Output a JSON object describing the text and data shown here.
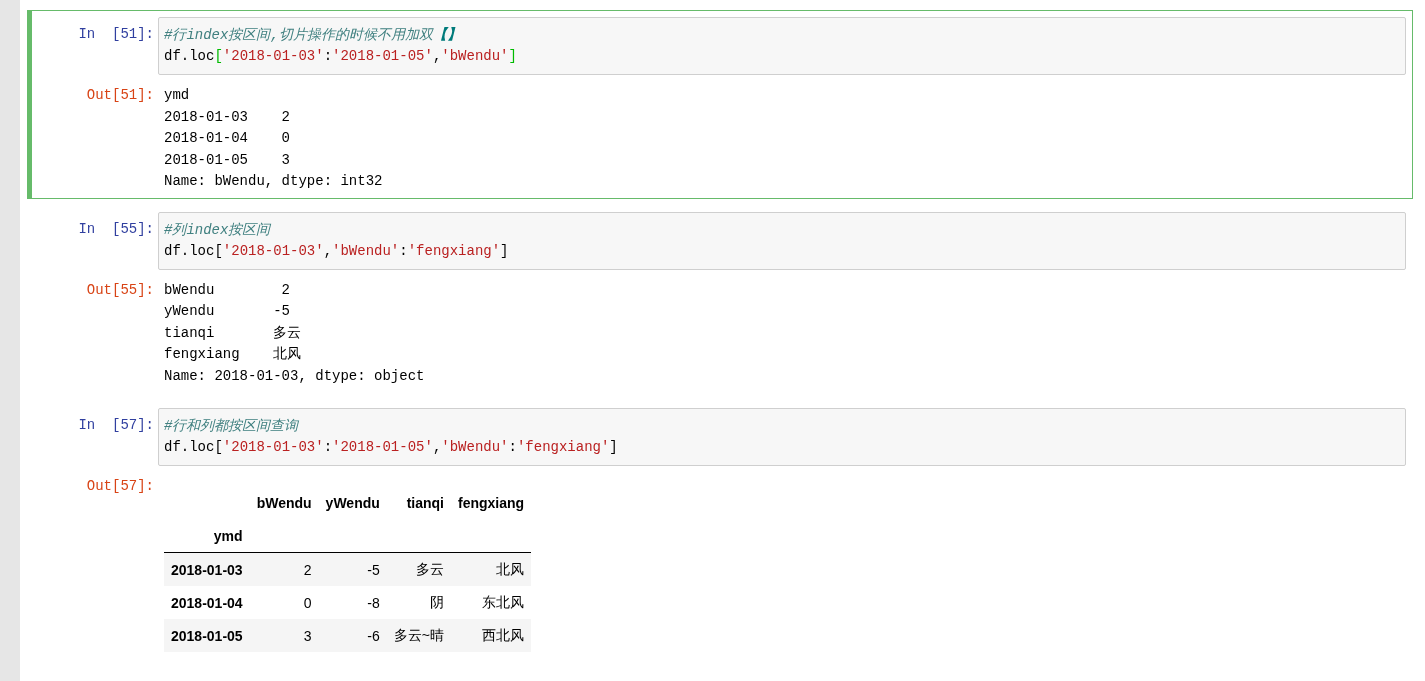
{
  "cells": [
    {
      "selected": true,
      "in_prompt": "In  [51]:",
      "out_prompt": "Out[51]:",
      "code": [
        [
          {
            "kind": "comment",
            "text": "#行index按区间,切片操作的时候不用加双**【】**"
          }
        ],
        [
          {
            "kind": "name",
            "text": "df.loc"
          },
          {
            "kind": "bracket_match",
            "text": "["
          },
          {
            "kind": "string",
            "text": "'2018-01-03'"
          },
          {
            "kind": "name",
            "text": ":"
          },
          {
            "kind": "string",
            "text": "'2018-01-05'"
          },
          {
            "kind": "name",
            "text": ","
          },
          {
            "kind": "string",
            "text": "'bWendu'"
          },
          {
            "kind": "bracket_match",
            "text": "]"
          }
        ]
      ],
      "output": {
        "kind": "text",
        "lines": [
          "ymd",
          "2018-01-03    2",
          "2018-01-04    0",
          "2018-01-05    3",
          "Name: bWendu, dtype: int32"
        ]
      }
    },
    {
      "selected": false,
      "in_prompt": "In  [55]:",
      "out_prompt": "Out[55]:",
      "code": [
        [
          {
            "kind": "comment",
            "text": "#列index按区间"
          }
        ],
        [
          {
            "kind": "name",
            "text": "df.loc"
          },
          {
            "kind": "bracket",
            "text": "["
          },
          {
            "kind": "string",
            "text": "'2018-01-03'"
          },
          {
            "kind": "name",
            "text": ","
          },
          {
            "kind": "string",
            "text": "'bWendu'"
          },
          {
            "kind": "name",
            "text": ":"
          },
          {
            "kind": "string",
            "text": "'fengxiang'"
          },
          {
            "kind": "bracket",
            "text": "]"
          }
        ]
      ],
      "output": {
        "kind": "text",
        "lines": [
          "bWendu        2",
          "yWendu       -5",
          "tianqi       多云",
          "fengxiang    北风",
          "Name: 2018-01-03, dtype: object"
        ]
      }
    },
    {
      "selected": false,
      "in_prompt": "In  [57]:",
      "out_prompt": "Out[57]:",
      "code": [
        [
          {
            "kind": "comment",
            "text": "#行和列都按区间查询"
          }
        ],
        [
          {
            "kind": "name",
            "text": "df.loc"
          },
          {
            "kind": "bracket",
            "text": "["
          },
          {
            "kind": "string",
            "text": "'2018-01-03'"
          },
          {
            "kind": "name",
            "text": ":"
          },
          {
            "kind": "string",
            "text": "'2018-01-05'"
          },
          {
            "kind": "name",
            "text": ","
          },
          {
            "kind": "string",
            "text": "'bWendu'"
          },
          {
            "kind": "name",
            "text": ":"
          },
          {
            "kind": "string",
            "text": "'fengxiang'"
          },
          {
            "kind": "bracket",
            "text": "]"
          }
        ]
      ],
      "output": {
        "kind": "table",
        "columns": [
          "bWendu",
          "yWendu",
          "tianqi",
          "fengxiang"
        ],
        "index_name": "ymd",
        "rows": [
          {
            "index": "2018-01-03",
            "values": [
              "2",
              "-5",
              "多云",
              "北风"
            ]
          },
          {
            "index": "2018-01-04",
            "values": [
              "0",
              "-8",
              "阴",
              "东北风"
            ]
          },
          {
            "index": "2018-01-05",
            "values": [
              "3",
              "-6",
              "多云~晴",
              "西北风"
            ]
          }
        ]
      }
    }
  ]
}
